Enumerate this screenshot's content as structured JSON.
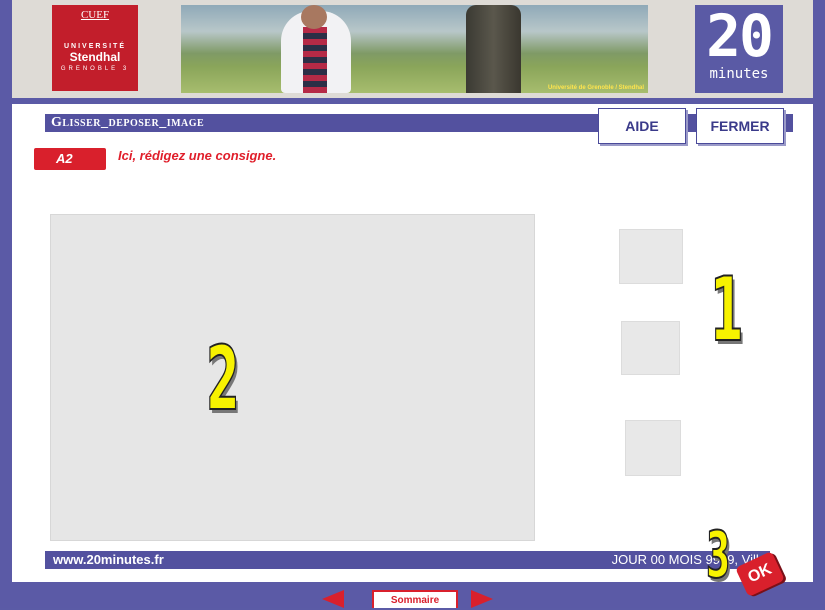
{
  "header": {
    "cuef": {
      "top": "CUEF",
      "mid": "UNIVERSITÉ",
      "name": "Stendhal",
      "bot": "GRENOBLE 3"
    },
    "photo_credit": "Université de Grenoble / Stendhal",
    "logo": {
      "number": "20",
      "word": "minutes"
    }
  },
  "page": {
    "title": "Glisser_deposer_image"
  },
  "toolbar": {
    "aide_label": "AIDE",
    "fermer_label": "FERMER"
  },
  "instruction": {
    "badge": "A2",
    "text": "Ici, rédigez une consigne."
  },
  "annotations": {
    "n1": "1",
    "n2": "2",
    "n3": "3"
  },
  "footer": {
    "url": "www.20minutes.fr",
    "date": "JOUR 00 MOIS 9999, Ville"
  },
  "ok_label": "OK",
  "nav": {
    "sommaire_label": "Sommaire"
  },
  "colors": {
    "frame": "#5b5aa6",
    "accent": "#d9202c",
    "title_bar": "#53519f",
    "marker": "#f7f200"
  }
}
